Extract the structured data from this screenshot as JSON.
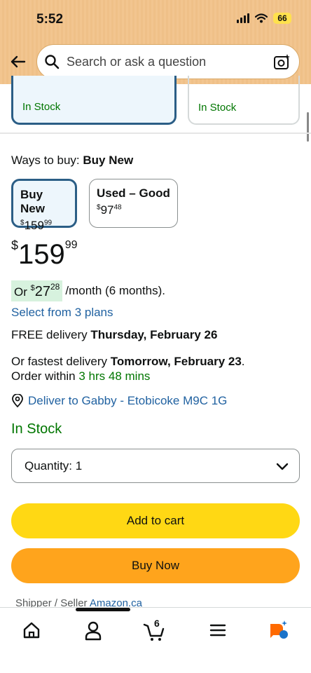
{
  "status": {
    "time": "5:52",
    "battery": "66"
  },
  "search": {
    "placeholder": "Search or ask a question"
  },
  "top_cards": [
    {
      "stock": "In Stock"
    },
    {
      "stock": "In Stock"
    }
  ],
  "ways_to_buy": {
    "label": "Ways to buy:",
    "selected": "Buy New"
  },
  "options": [
    {
      "name": "Buy New",
      "price_cur": "$",
      "price_whole": "159",
      "price_cents": "99"
    },
    {
      "name": "Used – Good",
      "price_cur": "$",
      "price_whole": "97",
      "price_cents": "48"
    }
  ],
  "price": {
    "cur": "$",
    "whole": "159",
    "cents": "99"
  },
  "monthly": {
    "prefix": "Or",
    "cur": "$",
    "whole": "27",
    "cents": "28",
    "suffix": "/month (6 months)."
  },
  "plans_link": "Select from 3 plans",
  "delivery": {
    "prefix": "FREE delivery",
    "date": "Thursday, February 26"
  },
  "fastest": {
    "prefix": "Or fastest delivery",
    "date": "Tomorrow, February 23",
    "suffix": ".",
    "order_within": "Order within",
    "time_left": "3 hrs 48 mins"
  },
  "deliver_to": "Deliver to Gabby - Etobicoke M9C 1G",
  "stock": "In Stock",
  "quantity": {
    "label": "Quantity: 1"
  },
  "buttons": {
    "add_to_cart": "Add to cart",
    "buy_now": "Buy Now"
  },
  "shipper": {
    "label": "Shipper / Seller",
    "value": "Amazon.ca"
  },
  "nav": {
    "cart_count": "6"
  },
  "colors": {
    "header": "#f2c58f",
    "add_to_cart": "#ffd814",
    "buy_now": "#ffa41c",
    "link": "#2162a1",
    "in_stock": "#007600",
    "selected_border": "#2b5e86"
  }
}
